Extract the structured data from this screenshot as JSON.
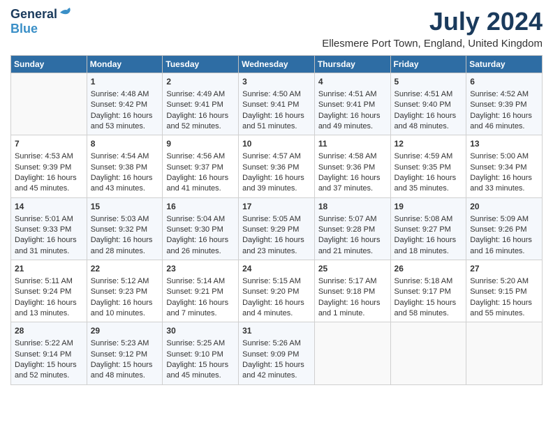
{
  "logo": {
    "general": "General",
    "blue": "Blue"
  },
  "title": "July 2024",
  "subtitle": "Ellesmere Port Town, England, United Kingdom",
  "days_header": [
    "Sunday",
    "Monday",
    "Tuesday",
    "Wednesday",
    "Thursday",
    "Friday",
    "Saturday"
  ],
  "weeks": [
    [
      {
        "day": "",
        "lines": []
      },
      {
        "day": "1",
        "lines": [
          "Sunrise: 4:48 AM",
          "Sunset: 9:42 PM",
          "Daylight: 16 hours",
          "and 53 minutes."
        ]
      },
      {
        "day": "2",
        "lines": [
          "Sunrise: 4:49 AM",
          "Sunset: 9:41 PM",
          "Daylight: 16 hours",
          "and 52 minutes."
        ]
      },
      {
        "day": "3",
        "lines": [
          "Sunrise: 4:50 AM",
          "Sunset: 9:41 PM",
          "Daylight: 16 hours",
          "and 51 minutes."
        ]
      },
      {
        "day": "4",
        "lines": [
          "Sunrise: 4:51 AM",
          "Sunset: 9:41 PM",
          "Daylight: 16 hours",
          "and 49 minutes."
        ]
      },
      {
        "day": "5",
        "lines": [
          "Sunrise: 4:51 AM",
          "Sunset: 9:40 PM",
          "Daylight: 16 hours",
          "and 48 minutes."
        ]
      },
      {
        "day": "6",
        "lines": [
          "Sunrise: 4:52 AM",
          "Sunset: 9:39 PM",
          "Daylight: 16 hours",
          "and 46 minutes."
        ]
      }
    ],
    [
      {
        "day": "7",
        "lines": [
          "Sunrise: 4:53 AM",
          "Sunset: 9:39 PM",
          "Daylight: 16 hours",
          "and 45 minutes."
        ]
      },
      {
        "day": "8",
        "lines": [
          "Sunrise: 4:54 AM",
          "Sunset: 9:38 PM",
          "Daylight: 16 hours",
          "and 43 minutes."
        ]
      },
      {
        "day": "9",
        "lines": [
          "Sunrise: 4:56 AM",
          "Sunset: 9:37 PM",
          "Daylight: 16 hours",
          "and 41 minutes."
        ]
      },
      {
        "day": "10",
        "lines": [
          "Sunrise: 4:57 AM",
          "Sunset: 9:36 PM",
          "Daylight: 16 hours",
          "and 39 minutes."
        ]
      },
      {
        "day": "11",
        "lines": [
          "Sunrise: 4:58 AM",
          "Sunset: 9:36 PM",
          "Daylight: 16 hours",
          "and 37 minutes."
        ]
      },
      {
        "day": "12",
        "lines": [
          "Sunrise: 4:59 AM",
          "Sunset: 9:35 PM",
          "Daylight: 16 hours",
          "and 35 minutes."
        ]
      },
      {
        "day": "13",
        "lines": [
          "Sunrise: 5:00 AM",
          "Sunset: 9:34 PM",
          "Daylight: 16 hours",
          "and 33 minutes."
        ]
      }
    ],
    [
      {
        "day": "14",
        "lines": [
          "Sunrise: 5:01 AM",
          "Sunset: 9:33 PM",
          "Daylight: 16 hours",
          "and 31 minutes."
        ]
      },
      {
        "day": "15",
        "lines": [
          "Sunrise: 5:03 AM",
          "Sunset: 9:32 PM",
          "Daylight: 16 hours",
          "and 28 minutes."
        ]
      },
      {
        "day": "16",
        "lines": [
          "Sunrise: 5:04 AM",
          "Sunset: 9:30 PM",
          "Daylight: 16 hours",
          "and 26 minutes."
        ]
      },
      {
        "day": "17",
        "lines": [
          "Sunrise: 5:05 AM",
          "Sunset: 9:29 PM",
          "Daylight: 16 hours",
          "and 23 minutes."
        ]
      },
      {
        "day": "18",
        "lines": [
          "Sunrise: 5:07 AM",
          "Sunset: 9:28 PM",
          "Daylight: 16 hours",
          "and 21 minutes."
        ]
      },
      {
        "day": "19",
        "lines": [
          "Sunrise: 5:08 AM",
          "Sunset: 9:27 PM",
          "Daylight: 16 hours",
          "and 18 minutes."
        ]
      },
      {
        "day": "20",
        "lines": [
          "Sunrise: 5:09 AM",
          "Sunset: 9:26 PM",
          "Daylight: 16 hours",
          "and 16 minutes."
        ]
      }
    ],
    [
      {
        "day": "21",
        "lines": [
          "Sunrise: 5:11 AM",
          "Sunset: 9:24 PM",
          "Daylight: 16 hours",
          "and 13 minutes."
        ]
      },
      {
        "day": "22",
        "lines": [
          "Sunrise: 5:12 AM",
          "Sunset: 9:23 PM",
          "Daylight: 16 hours",
          "and 10 minutes."
        ]
      },
      {
        "day": "23",
        "lines": [
          "Sunrise: 5:14 AM",
          "Sunset: 9:21 PM",
          "Daylight: 16 hours",
          "and 7 minutes."
        ]
      },
      {
        "day": "24",
        "lines": [
          "Sunrise: 5:15 AM",
          "Sunset: 9:20 PM",
          "Daylight: 16 hours",
          "and 4 minutes."
        ]
      },
      {
        "day": "25",
        "lines": [
          "Sunrise: 5:17 AM",
          "Sunset: 9:18 PM",
          "Daylight: 16 hours",
          "and 1 minute."
        ]
      },
      {
        "day": "26",
        "lines": [
          "Sunrise: 5:18 AM",
          "Sunset: 9:17 PM",
          "Daylight: 15 hours",
          "and 58 minutes."
        ]
      },
      {
        "day": "27",
        "lines": [
          "Sunrise: 5:20 AM",
          "Sunset: 9:15 PM",
          "Daylight: 15 hours",
          "and 55 minutes."
        ]
      }
    ],
    [
      {
        "day": "28",
        "lines": [
          "Sunrise: 5:22 AM",
          "Sunset: 9:14 PM",
          "Daylight: 15 hours",
          "and 52 minutes."
        ]
      },
      {
        "day": "29",
        "lines": [
          "Sunrise: 5:23 AM",
          "Sunset: 9:12 PM",
          "Daylight: 15 hours",
          "and 48 minutes."
        ]
      },
      {
        "day": "30",
        "lines": [
          "Sunrise: 5:25 AM",
          "Sunset: 9:10 PM",
          "Daylight: 15 hours",
          "and 45 minutes."
        ]
      },
      {
        "day": "31",
        "lines": [
          "Sunrise: 5:26 AM",
          "Sunset: 9:09 PM",
          "Daylight: 15 hours",
          "and 42 minutes."
        ]
      },
      {
        "day": "",
        "lines": []
      },
      {
        "day": "",
        "lines": []
      },
      {
        "day": "",
        "lines": []
      }
    ]
  ]
}
